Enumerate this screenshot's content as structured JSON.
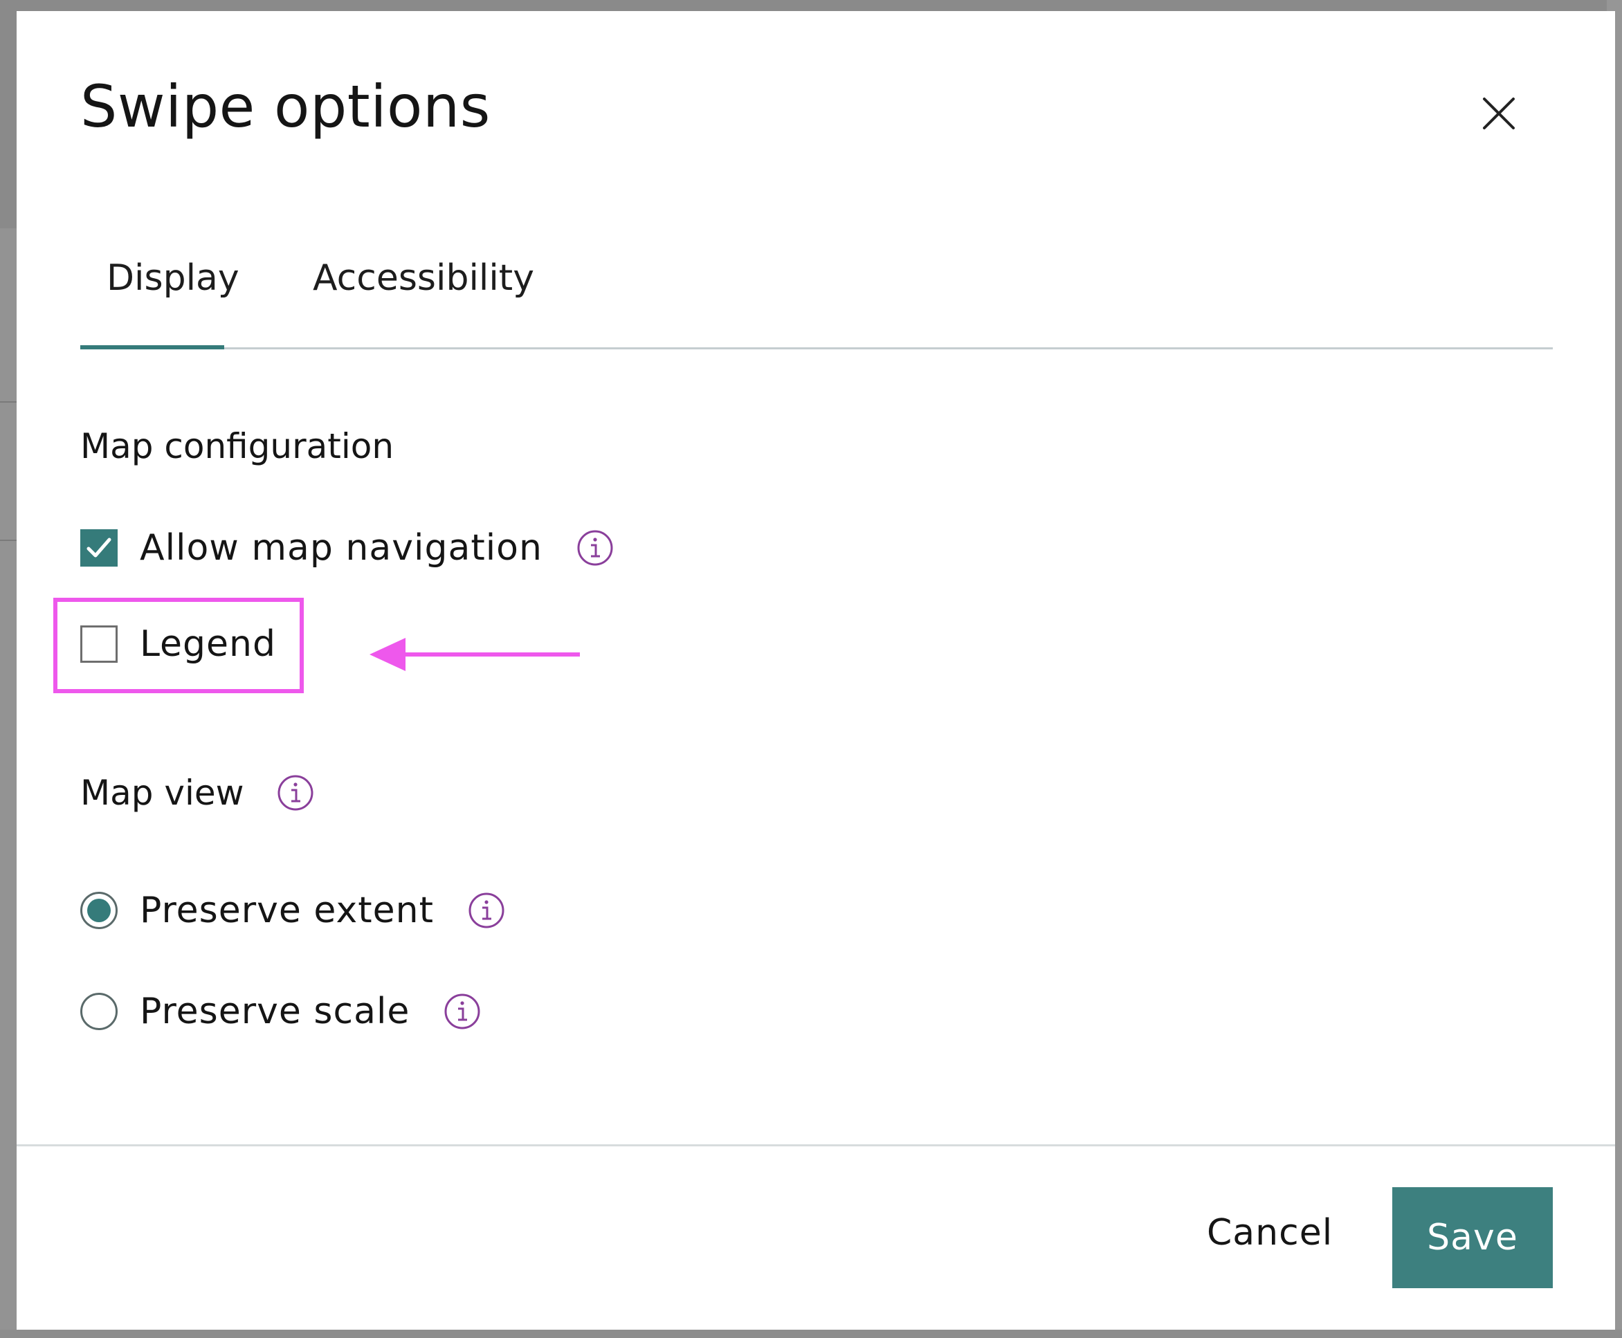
{
  "dialog": {
    "title": "Swipe options"
  },
  "tabs": [
    {
      "label": "Display",
      "active": true
    },
    {
      "label": "Accessibility",
      "active": false
    }
  ],
  "map_configuration": {
    "heading": "Map configuration",
    "options": [
      {
        "label": "Allow map navigation",
        "checked": true,
        "has_info": true
      },
      {
        "label": "Legend",
        "checked": false,
        "has_info": false
      }
    ]
  },
  "map_view": {
    "heading": "Map view",
    "options": [
      {
        "label": "Preserve extent",
        "selected": true
      },
      {
        "label": "Preserve scale",
        "selected": false
      }
    ]
  },
  "footer": {
    "cancel_label": "Cancel",
    "save_label": "Save"
  },
  "colors": {
    "accent": "#357b7a",
    "info_icon": "#8a3f9b",
    "annotation": "#ee58ec"
  },
  "icons": {
    "close": "close-icon",
    "info": "info-icon",
    "check": "checkmark-icon"
  }
}
